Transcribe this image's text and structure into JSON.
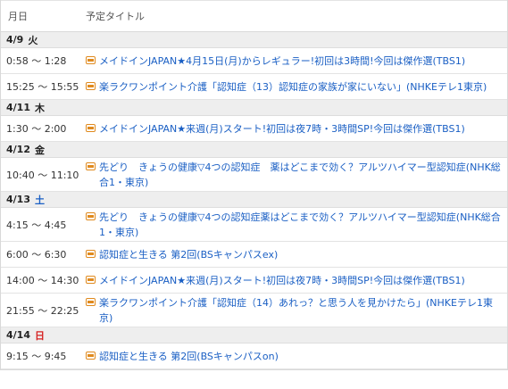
{
  "header": {
    "date_col": "月日",
    "title_col": "予定タイトル"
  },
  "days": [
    {
      "date": "4/9",
      "weekday": "火",
      "weekday_type": "weekday",
      "programs": [
        {
          "time": "0:58 ～ 1:28",
          "title": "メイドインJAPAN★4月15日(月)からレギュラー!初回は3時間!今回は傑作選(TBS1)"
        },
        {
          "time": "15:25 ～ 15:55",
          "title": "楽ラクワンポイント介護「認知症（13）認知症の家族が家にいない」(NHKEテレ1東京)"
        }
      ]
    },
    {
      "date": "4/11",
      "weekday": "木",
      "weekday_type": "weekday",
      "programs": [
        {
          "time": "1:30 ～ 2:00",
          "title": "メイドインJAPAN★来週(月)スタート!初回は夜7時・3時間SP!今回は傑作選(TBS1)"
        }
      ]
    },
    {
      "date": "4/12",
      "weekday": "金",
      "weekday_type": "weekday",
      "programs": [
        {
          "time": "10:40 ～ 11:10",
          "title": "先どり　きょうの健康▽4つの認知症　薬はどこまで効く？アルツハイマー型認知症(NHK総合1・東京)"
        }
      ]
    },
    {
      "date": "4/13",
      "weekday": "土",
      "weekday_type": "sat",
      "programs": [
        {
          "time": "4:15 ～ 4:45",
          "title": "先どり　きょうの健康▽4つの認知症薬はどこまで効く？アルツハイマー型認知症(NHK総合1・東京)"
        },
        {
          "time": "6:00 ～ 6:30",
          "title": "認知症と生きる 第2回(BSキャンパスex)"
        },
        {
          "time": "14:00 ～ 14:30",
          "title": "メイドインJAPAN★来週(月)スタート!初回は夜7時・3時間SP!今回は傑作選(TBS1)"
        },
        {
          "time": "21:55 ～ 22:25",
          "title": "楽ラクワンポイント介護「認知症（14）あれっ？と思う人を見かけたら」(NHKEテレ1東京)"
        }
      ]
    },
    {
      "date": "4/14",
      "weekday": "日",
      "weekday_type": "sun",
      "programs": [
        {
          "time": "9:15 ～ 9:45",
          "title": "認知症と生きる 第2回(BSキャンパスon)"
        }
      ]
    }
  ]
}
